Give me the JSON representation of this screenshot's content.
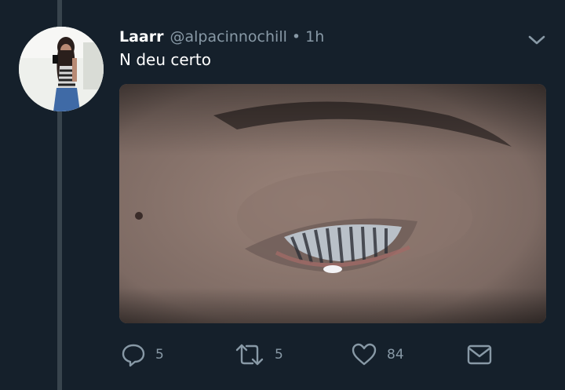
{
  "tweet": {
    "author_name": "Laarr",
    "handle": "@alpacinnochill",
    "separator": "•",
    "time": "1h",
    "text": "N deu certo",
    "avatar_icon": "user-avatar-photo",
    "media_icon": "eye-closeup-photo"
  },
  "actions": {
    "reply_count": "5",
    "retweet_count": "5",
    "like_count": "84"
  },
  "icons": {
    "more": "chevron-down-icon",
    "reply": "reply-icon",
    "retweet": "retweet-icon",
    "like": "heart-icon",
    "dm": "envelope-icon"
  },
  "colors": {
    "background": "#15202b",
    "secondary_text": "#8899a6",
    "thread_line": "#38444d"
  }
}
